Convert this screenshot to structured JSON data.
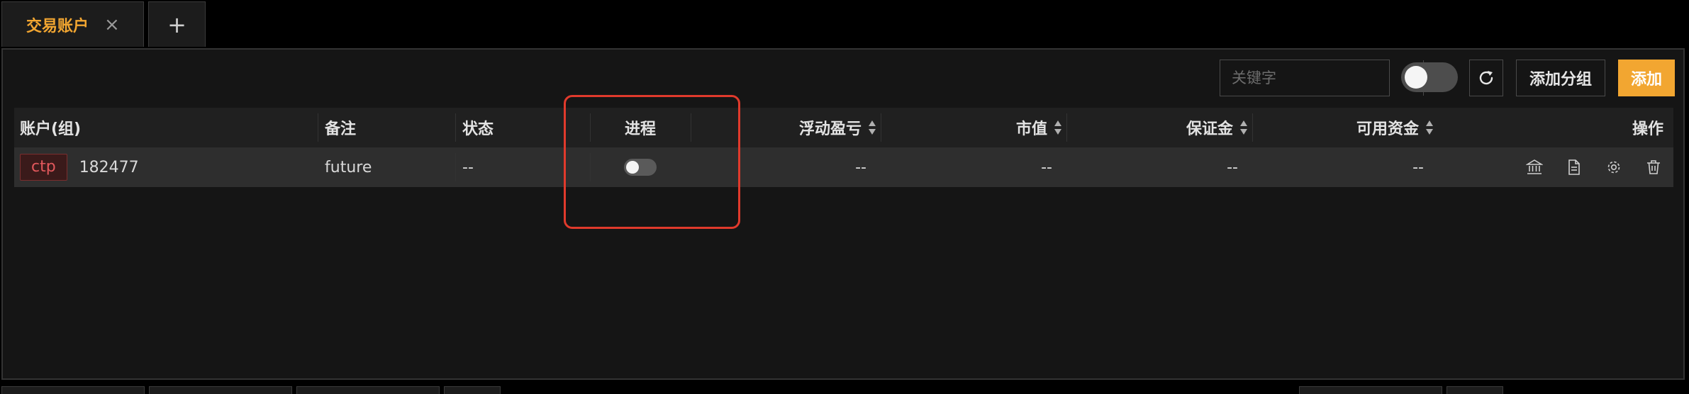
{
  "tabs": {
    "active_label": "交易账户",
    "close_glyph": "×",
    "add_glyph": "+"
  },
  "toolbar": {
    "search_placeholder": "关键字",
    "search_value": "",
    "search_icon": "search-icon",
    "toggle_on": false,
    "refresh_icon": "refresh-icon",
    "add_group_label": "添加分组",
    "add_label": "添加"
  },
  "table": {
    "headers": {
      "account": "账户(组)",
      "remark": "备注",
      "status": "状态",
      "process": "进程",
      "pnl": "浮动盈亏",
      "market_value": "市值",
      "margin": "保证金",
      "available": "可用资金",
      "actions": "操作"
    },
    "rows": [
      {
        "source": "ctp",
        "account_id": "182477",
        "remark": "future",
        "status": "--",
        "process_on": false,
        "pnl": "--",
        "market_value": "--",
        "margin": "--",
        "available": "--",
        "action_icons": [
          "bank-icon",
          "document-icon",
          "gear-icon",
          "trash-icon"
        ]
      }
    ]
  },
  "colors": {
    "accent": "#f2a631",
    "badge_text": "#e2585c",
    "highlight": "#e03a2c",
    "background": "#151515"
  }
}
